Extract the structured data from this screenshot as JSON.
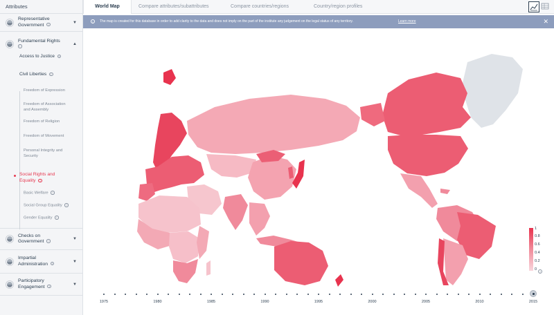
{
  "sidebar": {
    "header": "Attributes",
    "categories": [
      {
        "label1": "Representative",
        "label2": "Government"
      },
      {
        "label1": "Fundamental Rights",
        "label2": ""
      },
      {
        "label1": "Checks on",
        "label2": "Government"
      },
      {
        "label1": "Impartial",
        "label2": "Administration"
      },
      {
        "label1": "Participatory",
        "label2": "Engagement"
      }
    ],
    "sub": {
      "access_to_justice": "Access to Justice",
      "civil_liberties": "Civil Liberties",
      "freedom_expression": "Freedom of Expression",
      "freedom_association_1": "Freedom of Association",
      "freedom_association_2": "and Assembly",
      "freedom_religion": "Freedom of Religion",
      "freedom_movement": "Freedom of Movement",
      "personal_integrity_1": "Personal Integrity and",
      "personal_integrity_2": "Security",
      "social_rights_1": "Social Rights and",
      "social_rights_2": "Equality",
      "basic_welfare": "Basic Welfare",
      "social_group_equality": "Social Group Equality",
      "gender_equality": "Gender Equality"
    }
  },
  "tabs": [
    "World Map",
    "Compare attributes/subattributes",
    "Compare countries/regions",
    "Country/region profiles"
  ],
  "banner": {
    "message": "The map is created for this database in order to add clarity to the data and does not imply on the part of the institute any judgement on the legal status of any territory.",
    "learn_more": "Learn more",
    "close": "✕",
    "info": "i"
  },
  "legend": {
    "ticks": [
      "1",
      "0.8",
      "0.6",
      "0.4",
      "0.2",
      "0"
    ],
    "info": "?",
    "high_color": "#e8334e",
    "low_color": "#f9d7dd"
  },
  "timeline": {
    "years": [
      "1975",
      "1980",
      "1985",
      "1990",
      "1995",
      "2000",
      "2005",
      "2010",
      "2015"
    ],
    "selected": "2015"
  },
  "colors": {
    "accent": "#e63950",
    "banner": "#8d9dbd",
    "no_data": "#dfe3e8"
  }
}
